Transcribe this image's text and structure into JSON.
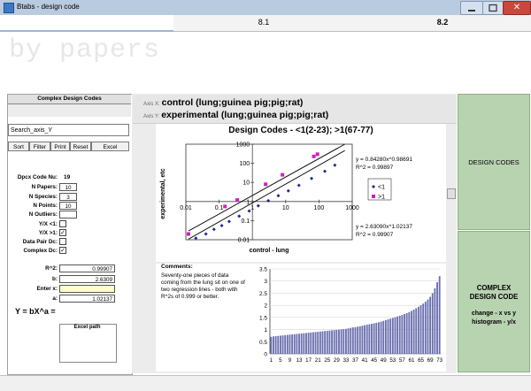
{
  "window": {
    "title": "Btabs - design code"
  },
  "tabs": [
    {
      "label": ""
    },
    {
      "label": "8.1"
    },
    {
      "label": "8.2"
    }
  ],
  "banner": "by papers",
  "left": {
    "header": "Complex Design Codes",
    "search_value": "Search_axis_Y",
    "buttons": [
      "Sort",
      "Filter",
      "Print",
      "Reset",
      "Excel"
    ],
    "fields": [
      {
        "label": "Dpcx Code Nu:",
        "value": "19"
      },
      {
        "label": "N Papers:",
        "value": "10"
      },
      {
        "label": "N Species:",
        "value": "3"
      },
      {
        "label": "N Points:",
        "value": "10"
      },
      {
        "label": "N Outliers:",
        "value": ""
      }
    ],
    "checks": [
      {
        "label": "Y/X <1:",
        "checked": false,
        "mark": ""
      },
      {
        "label": "Y/X >1:",
        "checked": true,
        "mark": "✓"
      },
      {
        "label": "Data Pair Dc:",
        "checked": false,
        "mark": ""
      },
      {
        "label": "Complex Dc:",
        "checked": true,
        "mark": "✓"
      }
    ],
    "values": [
      {
        "label": "R^2:",
        "value": "0.99907"
      },
      {
        "label": "b:",
        "value": "2.6309"
      },
      {
        "label": "Enter x:",
        "value": ""
      },
      {
        "label": "a:",
        "value": "1.02137"
      }
    ],
    "equation": "Y = bX^a =",
    "excel_path_label": "Excel path"
  },
  "axis": {
    "x_tag": "Axis X:",
    "x_value": "control (lung;guinea pig;pig;rat)",
    "y_tag": "Axis Y:",
    "y_value": "experimental (lung;guinea pig;pig;rat)"
  },
  "right": {
    "design_codes": "DESIGN CODES",
    "complex_line1": "COMPLEX",
    "complex_line2": "DESIGN CODE",
    "complex_sub1": "change - x vs y",
    "complex_sub2": "histogram - y/x"
  },
  "comments": {
    "label": "Comments:",
    "text": "Seventy-one pieces of data coming from the lung sit on one of two regression lines - both with R^2s of 0.999 or better."
  },
  "colors": {
    "series_lt1": "#1a2a8c",
    "series_gt1": "#d01fc0",
    "panel_green": "#b8d3b0",
    "hist_bar": "#6a6fae"
  },
  "chart_data": [
    {
      "type": "scatter",
      "title": "Design Codes - <1(2-23); >1(67-77)",
      "xlabel": "control - lung",
      "ylabel": "experimental, etc",
      "xscale": "log",
      "yscale": "log",
      "xlim": [
        0.01,
        1000
      ],
      "ylim": [
        0.01,
        1000
      ],
      "x_ticks": [
        "0.01",
        "0.1",
        "1",
        "10",
        "100",
        "1000"
      ],
      "y_ticks": [
        "0.01",
        "0.1",
        "1",
        "10",
        "100",
        "1000"
      ],
      "grid": false,
      "legend": "right",
      "series": [
        {
          "name": "<1",
          "color": "#1a2a8c",
          "x": [
            0.02,
            0.04,
            0.07,
            0.12,
            0.2,
            0.4,
            0.8,
            1.5,
            3,
            6,
            12,
            25,
            60,
            150,
            300
          ],
          "y": [
            0.012,
            0.02,
            0.035,
            0.055,
            0.09,
            0.17,
            0.32,
            0.6,
            1.1,
            2.0,
            3.6,
            7,
            16,
            38,
            80
          ]
        },
        {
          "name": ">1",
          "color": "#d01fc0",
          "x": [
            0.012,
            0.15,
            0.35,
            2.5,
            8,
            70,
            90
          ],
          "y": [
            0.02,
            0.55,
            1.2,
            8,
            25,
            230,
            300
          ]
        }
      ],
      "annotations": [
        {
          "text": "y = 0.84280x^0.98691",
          "near": "upper-right"
        },
        {
          "text": "R^2 = 0.99897",
          "near": "upper-right"
        },
        {
          "text": "y = 2.63090x^1.02137",
          "near": "lower-right"
        },
        {
          "text": "R^2 = 0.99907",
          "near": "lower-right"
        }
      ]
    },
    {
      "type": "bar",
      "title": "",
      "ylim": [
        0,
        3.5
      ],
      "y_ticks": [
        "0",
        "0.5",
        "1",
        "1.5",
        "2",
        "2.5",
        "3",
        "3.5"
      ],
      "x_ticks": [
        "1",
        "5",
        "9",
        "13",
        "17",
        "21",
        "25",
        "29",
        "33",
        "37",
        "41",
        "45",
        "49",
        "53",
        "57",
        "61",
        "65",
        "69",
        "73"
      ],
      "values": [
        0.7,
        0.72,
        0.73,
        0.74,
        0.75,
        0.76,
        0.77,
        0.78,
        0.79,
        0.8,
        0.81,
        0.82,
        0.83,
        0.84,
        0.85,
        0.86,
        0.87,
        0.88,
        0.89,
        0.9,
        0.91,
        0.92,
        0.93,
        0.94,
        0.95,
        0.96,
        0.97,
        0.98,
        0.99,
        1.0,
        1.01,
        1.02,
        1.03,
        1.05,
        1.07,
        1.09,
        1.1,
        1.12,
        1.14,
        1.16,
        1.18,
        1.2,
        1.22,
        1.24,
        1.26,
        1.28,
        1.3,
        1.33,
        1.36,
        1.39,
        1.42,
        1.45,
        1.48,
        1.51,
        1.54,
        1.57,
        1.6,
        1.64,
        1.68,
        1.72,
        1.77,
        1.82,
        1.88,
        1.94,
        2.0,
        2.07,
        2.15,
        2.24,
        2.35,
        2.5,
        2.7,
        2.95,
        3.2
      ]
    }
  ]
}
